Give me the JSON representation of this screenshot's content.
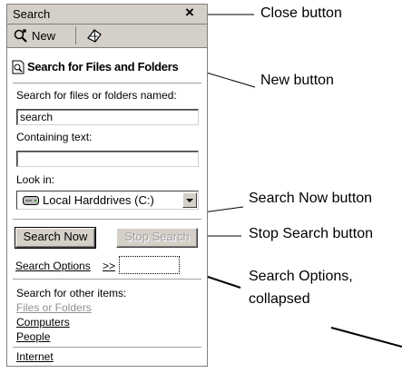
{
  "panel": {
    "title": "Search",
    "close_glyph": "×",
    "toolbar": {
      "new_label": "New"
    },
    "header_title": "Search for Files and Folders",
    "named_label": "Search for files or folders named:",
    "named_value": "search",
    "containing_label": "Containing text:",
    "containing_value": "",
    "look_in_label": "Look in:",
    "look_in_value": "Local Harddrives (C:)",
    "search_now_label": "Search Now",
    "stop_search_label": "Stop Search",
    "options_label": "Search Options",
    "options_chevron": ">>",
    "other_items_label": "Search for other items:",
    "other_items": [
      "Files or Folders",
      "Computers",
      "People"
    ],
    "internet_label": "Internet"
  },
  "callouts": {
    "close": "Close button",
    "new": "New button",
    "search_now": "Search Now button",
    "stop_search": "Stop Search button",
    "options_line1": "Search Options,",
    "options_line2": "collapsed"
  },
  "icons": {
    "new": "new-search-icon",
    "toolbar2": "assistant-icon",
    "header": "search-document-icon",
    "drive": "harddrive-icon"
  }
}
